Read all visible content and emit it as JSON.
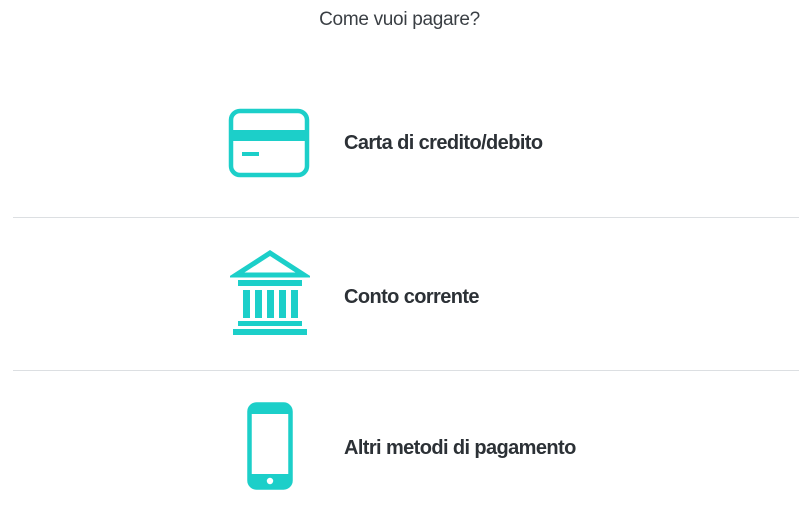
{
  "header": {
    "title": "Come vuoi pagare?"
  },
  "payment_options": [
    {
      "label": "Carta di credito/debito",
      "icon": "credit-card-icon"
    },
    {
      "label": "Conto corrente",
      "icon": "bank-icon"
    },
    {
      "label": "Altri metodi di pagamento",
      "icon": "smartphone-icon"
    }
  ],
  "colors": {
    "accent": "#1ccfc9",
    "divider": "#dcdfe2",
    "text": "#2c3136"
  }
}
